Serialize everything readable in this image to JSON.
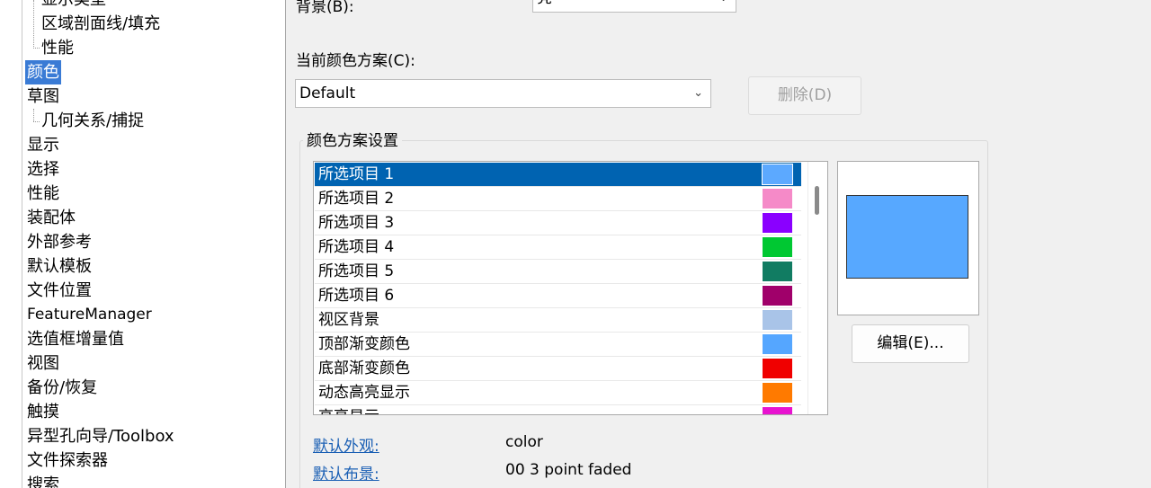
{
  "tree": {
    "items": [
      {
        "label": "显示类型"
      },
      {
        "label": "区域剖面线/填充"
      },
      {
        "label": "性能"
      },
      {
        "label": "颜色"
      },
      {
        "label": "草图"
      },
      {
        "label": "几何关系/捕捉"
      },
      {
        "label": "显示"
      },
      {
        "label": "选择"
      },
      {
        "label": "性能"
      },
      {
        "label": "装配体"
      },
      {
        "label": "外部参考"
      },
      {
        "label": "默认模板"
      },
      {
        "label": "文件位置"
      },
      {
        "label": "FeatureManager"
      },
      {
        "label": "选值框增量值"
      },
      {
        "label": "视图"
      },
      {
        "label": "备份/恢复"
      },
      {
        "label": "触摸"
      },
      {
        "label": "异型孔向导/Toolbox"
      },
      {
        "label": "文件探索器"
      },
      {
        "label": "搜索"
      }
    ],
    "selected_label": "颜色"
  },
  "background": {
    "label": "背景(B):",
    "value": "亮"
  },
  "scheme": {
    "label": "当前颜色方案(C):",
    "value": "Default",
    "delete_label": "删除(D)"
  },
  "settings": {
    "title": "颜色方案设置",
    "items": [
      {
        "label": "所选项目 1",
        "color": "#5ca9ff"
      },
      {
        "label": "所选项目 2",
        "color": "#f58ac8"
      },
      {
        "label": "所选项目 3",
        "color": "#8a00ff"
      },
      {
        "label": "所选项目 4",
        "color": "#00c832"
      },
      {
        "label": "所选项目 5",
        "color": "#117c62"
      },
      {
        "label": "所选项目 6",
        "color": "#a0006a"
      },
      {
        "label": "视区背景",
        "color": "#a9c4e8"
      },
      {
        "label": "顶部渐变颜色",
        "color": "#55a6ff"
      },
      {
        "label": "底部渐变颜色",
        "color": "#f00000"
      },
      {
        "label": "动态高亮显示",
        "color": "#ff7a00"
      },
      {
        "label": "高亮显示",
        "color": "#e812d0"
      }
    ],
    "preview_color": "#57a8ff",
    "edit_label": "编辑(E)..."
  },
  "footer": {
    "appearance_link": "默认外观:",
    "appearance_value": "color",
    "scene_link": "默认布景:",
    "scene_value": "00 3 point faded"
  }
}
